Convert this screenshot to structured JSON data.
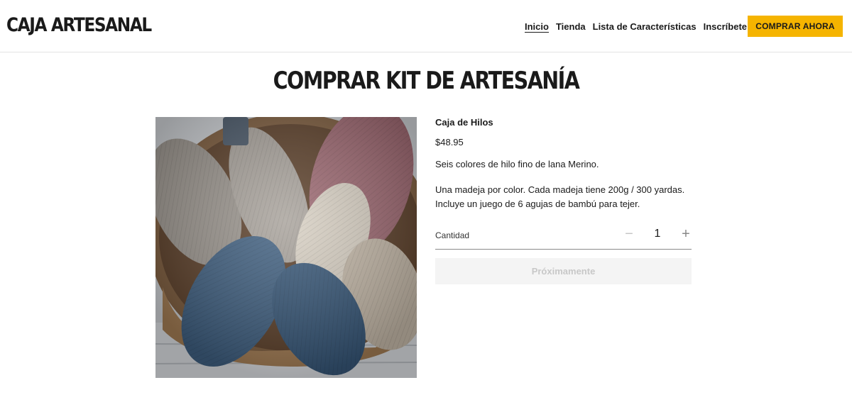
{
  "header": {
    "logo": "CAJA ARTESANAL",
    "nav": [
      {
        "label": "Inicio",
        "active": true
      },
      {
        "label": "Tienda"
      },
      {
        "label": "Lista de Características"
      },
      {
        "label": "Inscríbete"
      }
    ],
    "cta_label": "COMPRAR AHORA",
    "cta_color": "#f5b400"
  },
  "main": {
    "title": "COMPRAR KIT DE ARTESANÍA",
    "product": {
      "image": "yarn-skeins-in-basket",
      "name": "Caja de Hilos",
      "price": "$48.95",
      "description_1": "Seis colores de hilo fino de lana Merino.",
      "description_2": "Una madeja por color. Cada madeja tiene 200g / 300 yardas. Incluye un juego de 6 agujas de bambú para tejer.",
      "quantity_label": "Cantidad",
      "quantity": "1",
      "minus_icon": "minus-icon",
      "plus_icon": "plus-icon",
      "button_label": "Próximamente"
    }
  }
}
